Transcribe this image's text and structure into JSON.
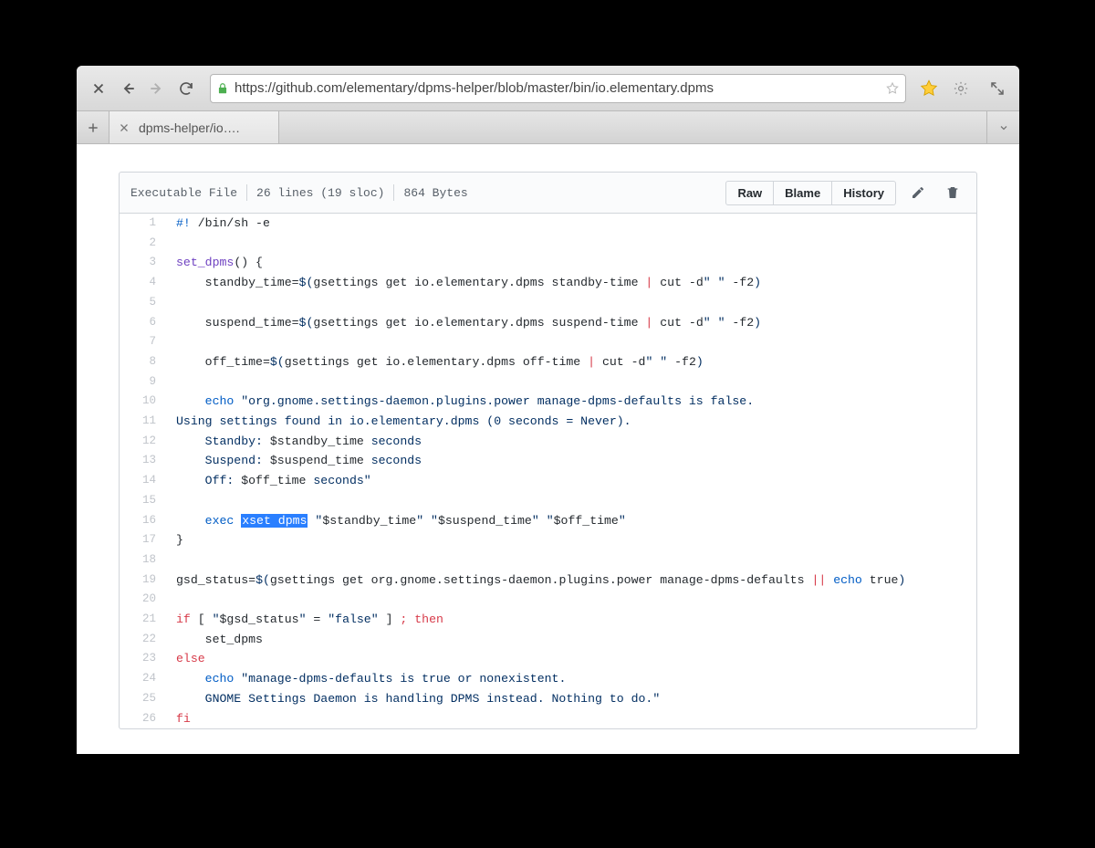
{
  "browser": {
    "url": "https://github.com/elementary/dpms-helper/blob/master/bin/io.elementary.dpms",
    "tab_title": "dpms-helper/io…."
  },
  "file_header": {
    "type": "Executable File",
    "lines": "26 lines (19 sloc)",
    "size": "864 Bytes",
    "raw": "Raw",
    "blame": "Blame",
    "history": "History"
  },
  "line_numbers": [
    "1",
    "2",
    "3",
    "4",
    "5",
    "6",
    "7",
    "8",
    "9",
    "10",
    "11",
    "12",
    "13",
    "14",
    "15",
    "16",
    "17",
    "18",
    "19",
    "20",
    "21",
    "22",
    "23",
    "24",
    "25",
    "26"
  ],
  "code": {
    "l1_a": "#!",
    "l1_b": " /bin/sh -e",
    "l3_a": "set_dpms",
    "l3_b": "() {",
    "l4_a": "    standby_time=",
    "l4_b": "$(",
    "l4_c": "gsettings get io.elementary.dpms standby-time ",
    "l4_d": "|",
    "l4_e": " cut -d",
    "l4_f": "\"",
    "l4_g": " ",
    "l4_h": "\"",
    "l4_i": " -f2",
    "l4_j": ")",
    "l6_a": "    suspend_time=",
    "l6_b": "$(",
    "l6_c": "gsettings get io.elementary.dpms suspend-time ",
    "l6_d": "|",
    "l6_e": " cut -d",
    "l6_f": "\"",
    "l6_g": " ",
    "l6_h": "\"",
    "l6_i": " -f2",
    "l6_j": ")",
    "l8_a": "    off_time=",
    "l8_b": "$(",
    "l8_c": "gsettings get io.elementary.dpms off-time ",
    "l8_d": "|",
    "l8_e": " cut -d",
    "l8_f": "\"",
    "l8_g": " ",
    "l8_h": "\"",
    "l8_i": " -f2",
    "l8_j": ")",
    "l10_a": "    ",
    "l10_b": "echo",
    "l10_c": " ",
    "l10_d": "\"",
    "l10_e": "org.gnome.settings-daemon.plugins.power manage-dpms-defaults is false.",
    "l11": "Using settings found in io.elementary.dpms (0 seconds = Never).",
    "l12_a": "    Standby: ",
    "l12_b": "$standby_time",
    "l12_c": " seconds",
    "l13_a": "    Suspend: ",
    "l13_b": "$suspend_time",
    "l13_c": " seconds",
    "l14_a": "    Off: ",
    "l14_b": "$off_time",
    "l14_c": " seconds",
    "l14_d": "\"",
    "l16_a": "    ",
    "l16_b": "exec",
    "l16_c": " ",
    "l16_sel": "xset dpms",
    "l16_d": " ",
    "l16_e": "\"",
    "l16_f": "$standby_time",
    "l16_g": "\"",
    "l16_h": " ",
    "l16_i": "\"",
    "l16_j": "$suspend_time",
    "l16_k": "\"",
    "l16_l": " ",
    "l16_m": "\"",
    "l16_n": "$off_time",
    "l16_o": "\"",
    "l17": "}",
    "l19_a": "gsd_status=",
    "l19_b": "$(",
    "l19_c": "gsettings get org.gnome.settings-daemon.plugins.power manage-dpms-defaults ",
    "l19_d": "||",
    "l19_e": " ",
    "l19_f": "echo",
    "l19_g": " true",
    "l19_h": ")",
    "l21_a": "if",
    "l21_b": " [ ",
    "l21_c": "\"",
    "l21_d": "$gsd_status",
    "l21_e": "\"",
    "l21_f": " = ",
    "l21_g": "\"",
    "l21_h": "false",
    "l21_i": "\"",
    "l21_j": " ] ",
    "l21_k": ";",
    "l21_l": " ",
    "l21_m": "then",
    "l22": "    set_dpms",
    "l23": "else",
    "l24_a": "    ",
    "l24_b": "echo",
    "l24_c": " ",
    "l24_d": "\"",
    "l24_e": "manage-dpms-defaults is true or nonexistent.",
    "l25_a": "    GNOME Settings Daemon is handling DPMS instead. Nothing to do.",
    "l25_b": "\"",
    "l26": "fi"
  }
}
